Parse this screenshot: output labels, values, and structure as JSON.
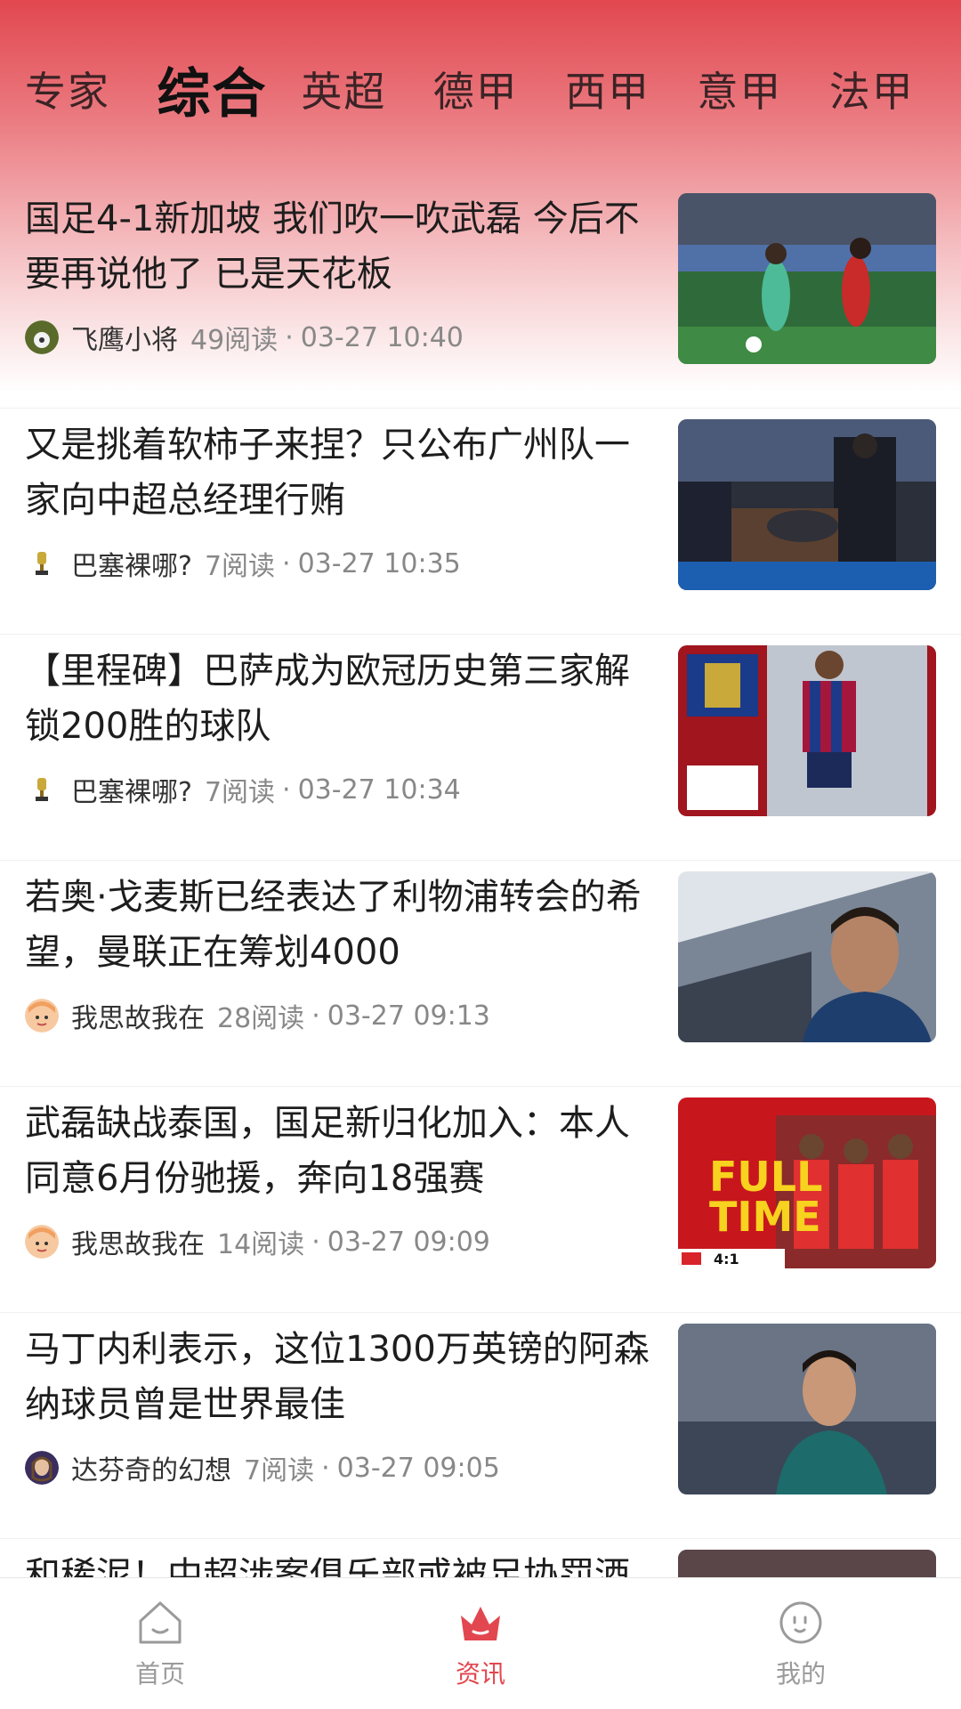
{
  "tabs": [
    "专家",
    "综合",
    "英超",
    "德甲",
    "西甲",
    "意甲",
    "法甲"
  ],
  "active_tab": "综合",
  "articles": [
    {
      "title": "国足4-1新加坡 我们吹一吹武磊 今后不要再说他了 已是天花板",
      "author": "飞鹰小将",
      "reads": "49阅读",
      "time": "03-27 10:40",
      "avatar_icon": "soccer-avatar-icon",
      "thumb_icon": "soccer-match-image"
    },
    {
      "title": "又是挑着软柿子来捏？只公布广州队一家向中超总经理行贿",
      "author": "巴塞裸哪?",
      "reads": "7阅读",
      "time": "03-27 10:35",
      "avatar_icon": "trophy-avatar-icon",
      "thumb_icon": "court-scene-image"
    },
    {
      "title": "【里程碑】巴萨成为欧冠历史第三家解锁200胜的球队",
      "author": "巴塞裸哪?",
      "reads": "7阅读",
      "time": "03-27 10:34",
      "avatar_icon": "trophy-avatar-icon",
      "thumb_icon": "barcelona-player-image"
    },
    {
      "title": "若奥·戈麦斯已经表达了利物浦转会的希望，曼联正在筹划4000",
      "author": "我思故我在",
      "reads": "28阅读",
      "time": "03-27 09:13",
      "avatar_icon": "cartoon-avatar-icon",
      "thumb_icon": "player-portrait-image"
    },
    {
      "title": "武磊缺战泰国，国足新归化加入：本人同意6月份驰援，奔向18强赛",
      "author": "我思故我在",
      "reads": "14阅读",
      "time": "03-27 09:09",
      "avatar_icon": "cartoon-avatar-icon",
      "thumb_icon": "full-time-graphic-image"
    },
    {
      "title": "马丁内利表示，这位1300万英镑的阿森纳球员曾是世界最佳",
      "author": "达芬奇的幻想",
      "reads": "7阅读",
      "time": "03-27 09:05",
      "avatar_icon": "portrait-avatar-icon",
      "thumb_icon": "arsenal-player-image"
    },
    {
      "title": "和稀泥！中超涉案俱乐部或被足协罚酒",
      "author": "",
      "reads": "",
      "time": "",
      "avatar_icon": "",
      "thumb_icon": "partial-news-image"
    }
  ],
  "thumb_texts": {
    "full": "FULL",
    "time": "TIME",
    "score": "4:1"
  },
  "bottom_nav": [
    {
      "label": "首页",
      "icon": "home-icon"
    },
    {
      "label": "资讯",
      "icon": "crown-icon"
    },
    {
      "label": "我的",
      "icon": "profile-face-icon"
    }
  ],
  "active_nav": "资讯",
  "colors": {
    "accent": "#e2474f",
    "nav_inactive": "#9a9a9a",
    "meta_text": "#888888"
  }
}
